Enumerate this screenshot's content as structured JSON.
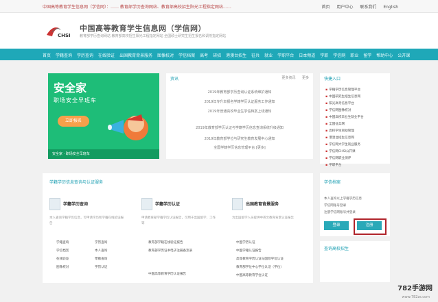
{
  "topbar": {
    "notice": "中国高等教育学生信息网（学信网）：…… 教育部学历查询网站、教育部高校招生阳光工程指定网站……",
    "links": [
      "首页",
      "用户中心",
      "联系我们",
      "English"
    ]
  },
  "header": {
    "logo_text": "CHSI",
    "title": "中国高等教育学生信息网（学信网）",
    "subtitle": "教育部学历查询网站 教育部高校招生阳光工程指定网站 全国硕士研究生招生报名和调剂指定网站"
  },
  "nav": {
    "items": [
      "首页",
      "学籍查询",
      "学历查询",
      "在线验证",
      "出国教育背景服务",
      "图像校对",
      "学信档案",
      "高考",
      "研招",
      "港澳台招生",
      "征兵",
      "就业",
      "学职平台",
      "日本频道",
      "学职",
      "学信网",
      "职业",
      "留学",
      "帮助中心",
      "公开课"
    ]
  },
  "banner": {
    "title": "安全家",
    "subtitle": "职场安全早班车",
    "button": "立即报名",
    "footer": "安全家 · 职场安全早班车"
  },
  "news": {
    "heading": "资讯",
    "more": [
      "更多资讯",
      "更多"
    ],
    "lines": [
      "2019年教育部学历查询认证系统维护通知",
      "2019年专升本报名学籍学历认证服务工作通知",
      "2019年普通高校毕业生学信档案上线通知",
      "2019年教育部学历认证与学籍学历信息查询系统升级通知",
      "2019年教育部学位与研究生教育发展中心通知",
      "全国学籍学历信息管理平台  [更多]"
    ]
  },
  "quick": {
    "heading": "快捷入口",
    "items": [
      "学籍学历信息管理平台",
      "中国研究生招生信息网",
      "阳光高考信息平台",
      "学信网图像校对",
      "中国高校毕业生就业平台",
      "全国征兵网",
      "高校学生资助管理",
      "港澳台招生信息网",
      "学信网大学生就业服务",
      "学信网CHSI公开课",
      "学信网职业测评",
      "学职平台"
    ]
  },
  "services": {
    "heading": "学籍学历信息查询与认证服务",
    "columns": [
      {
        "title": "学籍学历查询",
        "desc": "本人查询学籍学历信息，可申请学历和学籍在线验证报告",
        "links": [
          [
            "学籍查询",
            "学历查询"
          ],
          [
            "学信档案",
            "本人查询"
          ],
          [
            "在线验证",
            "零散查询"
          ],
          [
            "图像校对",
            "学历认证"
          ]
        ]
      },
      {
        "title": "学籍学历认证",
        "desc": "申请教育部学籍学历认证报告，可用于出国留学、工作等",
        "links": [
          [
            "教育部学籍在线验证报告",
            ""
          ],
          [
            "教育部学历证书电子注册备案表",
            ""
          ],
          [
            "中国高等教育学历认证报告",
            ""
          ]
        ]
      },
      {
        "title": "出国教育背景服务",
        "desc": "为出国留学人员提供中英文教育背景认证报告",
        "links": [
          [
            "中国学历认证",
            ""
          ],
          [
            "中国学籍认证报告",
            ""
          ],
          [
            "高等教育学历认证与国际学位认证",
            ""
          ],
          [
            "教育部学位中心学位认证（学位）",
            ""
          ],
          [
            "中国高等教育学位认证",
            ""
          ]
        ]
      }
    ]
  },
  "login": {
    "heading": "学信档案",
    "lines": [
      "本人查询以上学籍学历信息",
      "学信网账号登录",
      "注册学信网账号并登录"
    ],
    "login_button": "登录",
    "register_button": "注册"
  },
  "mobile": {
    "heading": "查询高校招生"
  },
  "watermark": {
    "brand": "782手游网",
    "url": "www.782zs.com"
  }
}
